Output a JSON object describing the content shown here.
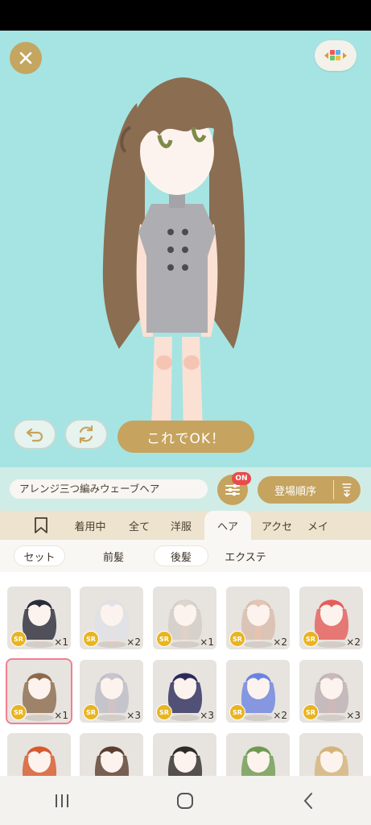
{
  "item_name": "アレンジ三つ編みウェーブヘア",
  "buttons": {
    "ok_label": "これでOK！",
    "on_badge": "ON",
    "sort_label": "登場順序"
  },
  "category_tabs": [
    {
      "label": "",
      "icon": "bookmark-icon"
    },
    {
      "label": "着用中"
    },
    {
      "label": "全て"
    },
    {
      "label": "洋服"
    },
    {
      "label": "ヘア",
      "active": true
    },
    {
      "label": "アクセ"
    },
    {
      "label": "メイ"
    }
  ],
  "sub_tabs": [
    {
      "label": "セット"
    },
    {
      "label": "前髪"
    },
    {
      "label": "後髪"
    },
    {
      "label": "エクステ"
    }
  ],
  "items": [
    {
      "rarity": "SR",
      "qty": "×1",
      "hair": "#2a2b3a",
      "faded": false
    },
    {
      "rarity": "SR",
      "qty": "×2",
      "hair": "#dfe1e6",
      "faded": false
    },
    {
      "rarity": "SR",
      "qty": "×1",
      "hair": "#b9b1aa",
      "faded": true
    },
    {
      "rarity": "SR",
      "qty": "×2",
      "hair": "#c88e6e",
      "faded": true
    },
    {
      "rarity": "SR",
      "qty": "×2",
      "hair": "#e55d5a",
      "faded": false
    },
    {
      "rarity": "SR",
      "qty": "×1",
      "hair": "#8b6a4c",
      "faded": false,
      "selected": true
    },
    {
      "rarity": "SR",
      "qty": "×3",
      "hair": "#8c8ca8",
      "faded": true
    },
    {
      "rarity": "SR",
      "qty": "×3",
      "hair": "#2c2a5c",
      "faded": false
    },
    {
      "rarity": "SR",
      "qty": "×2",
      "hair": "#6b83e0",
      "faded": false
    },
    {
      "rarity": "SR",
      "qty": "×3",
      "hair": "#8a7380",
      "faded": true
    },
    {
      "rarity": "",
      "qty": "",
      "hair": "#d7592c",
      "faded": false
    },
    {
      "rarity": "",
      "qty": "",
      "hair": "#5a3e30",
      "faded": false
    },
    {
      "rarity": "",
      "qty": "",
      "hair": "#2e2a28",
      "faded": false
    },
    {
      "rarity": "",
      "qty": "",
      "hair": "#6f9a50",
      "faded": false
    },
    {
      "rarity": "",
      "qty": "",
      "hair": "#d5b47a",
      "faded": false
    }
  ],
  "colors": {
    "accent": "#c6a35e",
    "stage": "#a5e4e2",
    "badge": "#e84b4b",
    "selected": "#f07f92"
  },
  "nav": [
    "recent-apps-icon",
    "home-icon",
    "back-icon"
  ]
}
